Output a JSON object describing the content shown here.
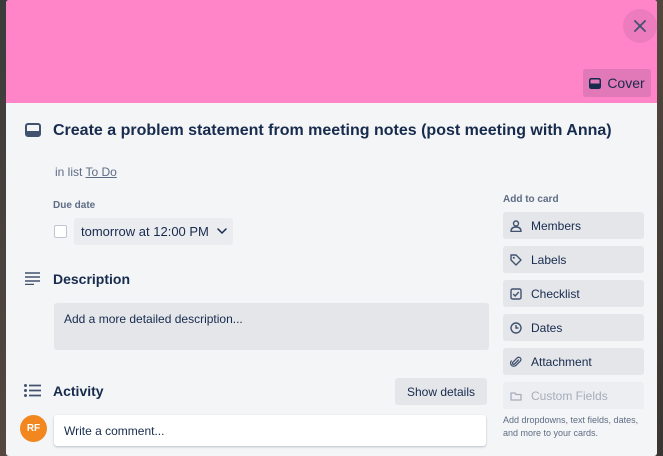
{
  "modal": {
    "cover_color": "#ff85c8",
    "cover_button_label": "Cover",
    "title": "Create a problem statement from meeting notes (post meeting with Anna)",
    "list_prefix": "in list",
    "list_name": "To Do"
  },
  "due_date": {
    "label": "Due date",
    "value": "tomorrow at 12:00 PM"
  },
  "description": {
    "heading": "Description",
    "placeholder": "Add a more detailed description..."
  },
  "activity": {
    "heading": "Activity",
    "show_details_label": "Show details",
    "avatar_initials": "RF",
    "avatar_color": "#f2861f",
    "comment_placeholder": "Write a comment..."
  },
  "sidebar": {
    "heading": "Add to card",
    "items": [
      {
        "label": "Members",
        "icon": "person-icon"
      },
      {
        "label": "Labels",
        "icon": "tag-icon"
      },
      {
        "label": "Checklist",
        "icon": "checkbox-icon"
      },
      {
        "label": "Dates",
        "icon": "clock-icon"
      },
      {
        "label": "Attachment",
        "icon": "paperclip-icon"
      },
      {
        "label": "Custom Fields",
        "icon": "custom-fields-icon",
        "disabled": true
      }
    ],
    "hint": "Add dropdowns, text fields, dates, and more to your cards."
  }
}
